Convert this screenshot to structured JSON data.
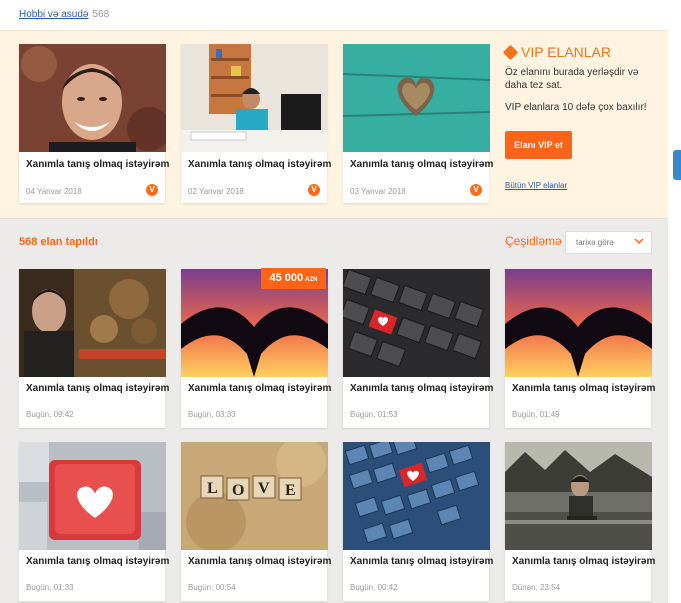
{
  "breadcrumb": {
    "link": "Hobbi və asudə",
    "count": "568"
  },
  "vip_cards": [
    {
      "title": "Xanımla tanış olmaq istəyirəm",
      "date": "04 Yanvar 2018",
      "badge": "V",
      "icon": "person-photo"
    },
    {
      "title": "Xanımla tanış olmaq istəyirəm",
      "date": "02 Yanvar 2018",
      "badge": "V",
      "icon": "office-photo"
    },
    {
      "title": "Xanımla tanış olmaq istəyirəm",
      "date": "03 Yanvar 2018",
      "badge": "V",
      "icon": "wood-heart-photo"
    }
  ],
  "vip_panel": {
    "title": "VIP ELANLAR",
    "text1": "Öz elanını burada yerləşdir və daha tez sat.",
    "text2": "VIP elanlara 10 dəfə çox baxılır!",
    "button": "Elanı VIP et",
    "all_link": "Bütün VIP elanlar",
    "accent": "#ff6419"
  },
  "results": {
    "found": "568 elan tapıldı",
    "sort_label": "Çeşidləmə",
    "sort_value": "tarixə görə"
  },
  "listings": [
    {
      "title": "Xanımla tanış olmaq istəyirəm",
      "date": "Bugün, 09:42",
      "icon": "poster-photo"
    },
    {
      "title": "Xanımla tanış olmaq istəyirəm",
      "date": "Bugün, 03:33",
      "icon": "hands-heart-photo",
      "price": "45 000",
      "currency": "AZN"
    },
    {
      "title": "Xanımla tanış olmaq istəyirəm",
      "date": "Bugün, 01:53",
      "icon": "keyboard-heart-photo"
    },
    {
      "title": "Xanımla tanış olmaq istəyirəm",
      "date": "Bugün, 01:49",
      "icon": "hands-heart-photo"
    },
    {
      "title": "Xanımla tanış olmaq istəyirəm",
      "date": "Bugün, 01:33",
      "icon": "red-key-heart-photo"
    },
    {
      "title": "Xanımla tanış olmaq istəyirəm",
      "date": "Bugün, 00:54",
      "icon": "love-tiles-photo"
    },
    {
      "title": "Xanımla tanış olmaq istəyirəm",
      "date": "Bugün, 00:42",
      "icon": "blue-keyboard-heart-photo"
    },
    {
      "title": "Xanımla tanış olmaq istəyirəm",
      "date": "Dünən, 23:54",
      "icon": "man-sitting-photo"
    }
  ]
}
